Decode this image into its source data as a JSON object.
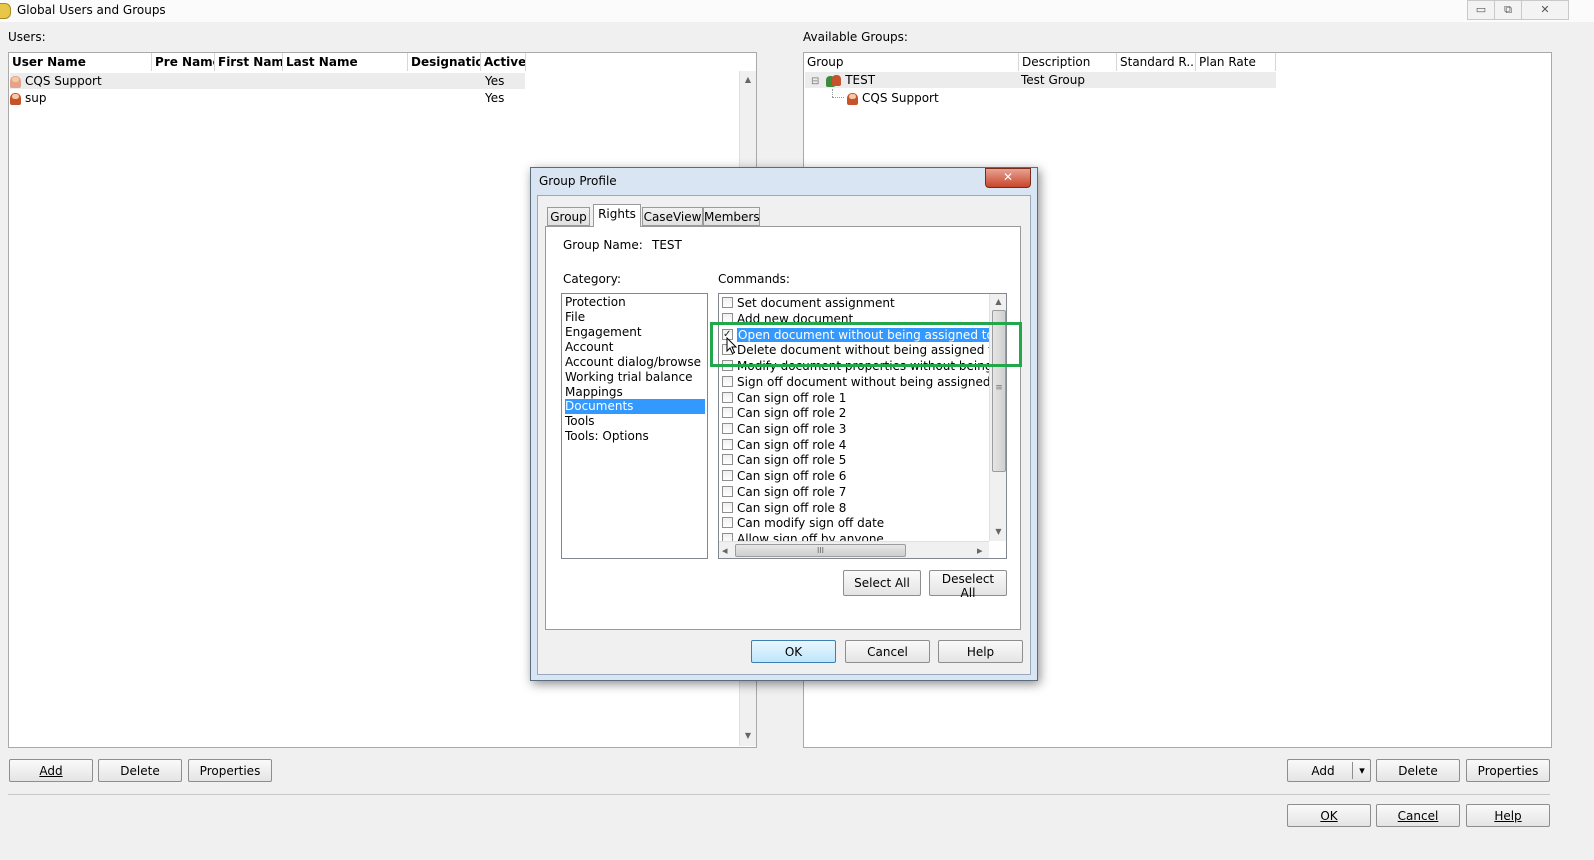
{
  "window": {
    "title": "Global Users and Groups",
    "minimize_glyph": "▭",
    "restore_glyph": "⧉",
    "close_glyph": "✕"
  },
  "users": {
    "label": "Users:",
    "columns": [
      "User Name",
      "Pre Name",
      "First Name",
      "Last Name",
      "Designation",
      "Active"
    ],
    "rows": [
      {
        "user_name": "CQS Support",
        "active": "Yes"
      },
      {
        "user_name": "sup",
        "active": "Yes"
      }
    ],
    "buttons": {
      "add": "Add",
      "delete": "Delete",
      "properties": "Properties"
    }
  },
  "groups": {
    "label": "Available Groups:",
    "columns": [
      "Group",
      "Description",
      "Standard R...",
      "Plan Rate"
    ],
    "tree": [
      {
        "name": "TEST",
        "description": "Test Group",
        "expander": "⊟"
      },
      {
        "name": "CQS Support"
      }
    ],
    "buttons": {
      "add": "Add",
      "dropdown": "▾",
      "delete": "Delete",
      "properties": "Properties"
    }
  },
  "footer": {
    "ok": "OK",
    "cancel": "Cancel",
    "help": "Help"
  },
  "dialog": {
    "title": "Group Profile",
    "close_glyph": "✕",
    "tabs": [
      "Group",
      "Rights",
      "CaseView",
      "Members"
    ],
    "group_name_label": "Group Name:",
    "group_name_value": "TEST",
    "category_label": "Category:",
    "commands_label": "Commands:",
    "categories": [
      "Protection",
      "File",
      "Engagement",
      "Account",
      "Account dialog/browse",
      "Working trial balance",
      "Mappings",
      "Documents",
      "Tools",
      "Tools: Options"
    ],
    "selected_category": "Documents",
    "commands": [
      {
        "label": "Set document assignment",
        "checked": false
      },
      {
        "label": "Add new document",
        "checked": false
      },
      {
        "label": "Open document without being assigned to docu",
        "checked": true
      },
      {
        "label": "Delete document without being assigned to docu",
        "checked": false
      },
      {
        "label": "Modify document properties without being assig",
        "checked": false
      },
      {
        "label": "Sign off document without being assigned to do",
        "checked": false
      },
      {
        "label": "Can sign off role 1",
        "checked": false
      },
      {
        "label": "Can sign off role 2",
        "checked": false
      },
      {
        "label": "Can sign off role 3",
        "checked": false
      },
      {
        "label": "Can sign off role 4",
        "checked": false
      },
      {
        "label": "Can sign off role 5",
        "checked": false
      },
      {
        "label": "Can sign off role 6",
        "checked": false
      },
      {
        "label": "Can sign off role 7",
        "checked": false
      },
      {
        "label": "Can sign off role 8",
        "checked": false
      },
      {
        "label": "Can modify sign off date",
        "checked": false
      },
      {
        "label": "Allow sign off by anyone",
        "checked": false
      }
    ],
    "scroll": {
      "up": "▲",
      "down": "▼",
      "left": "◂",
      "right": "▸",
      "grip": "≡",
      "hgrip": "III"
    },
    "select_all": "Select All",
    "deselect_all": "Deselect All",
    "ok": "OK",
    "cancel": "Cancel",
    "help": "Help"
  }
}
